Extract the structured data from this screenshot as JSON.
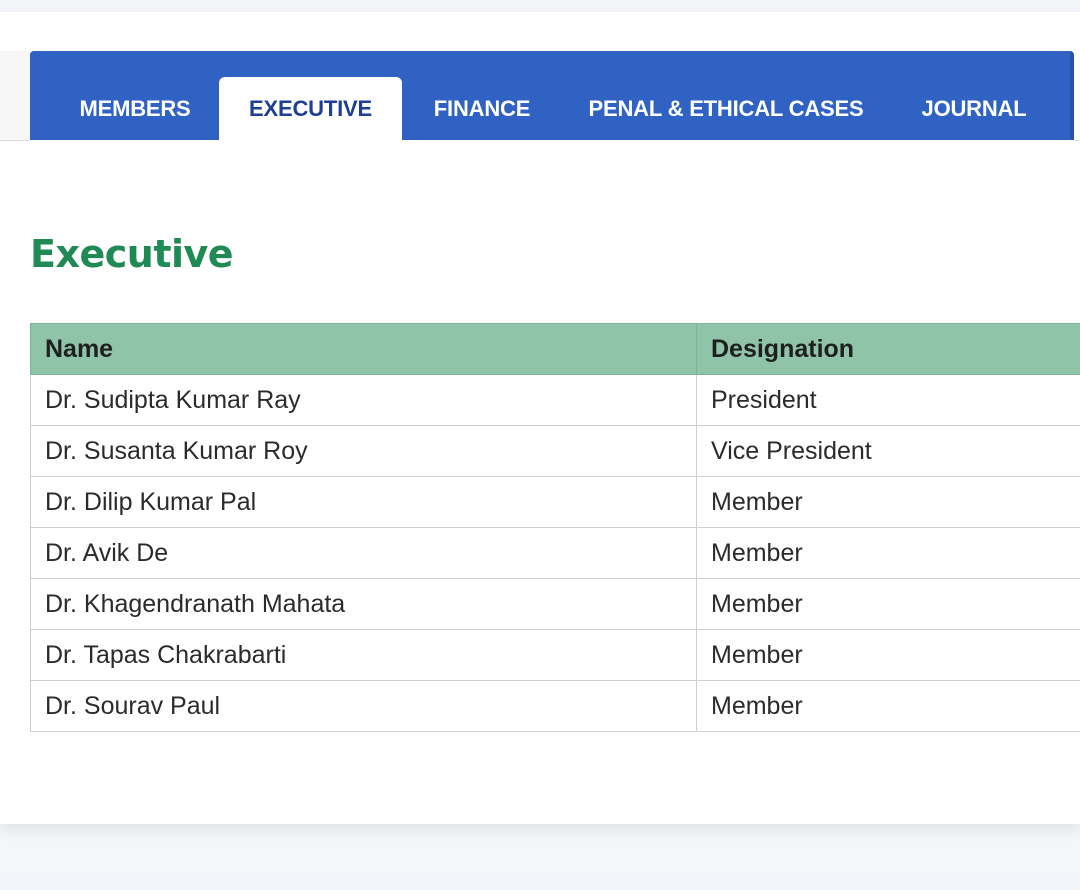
{
  "tabs": [
    {
      "label": "MEMBERS",
      "active": false
    },
    {
      "label": "EXECUTIVE",
      "active": true
    },
    {
      "label": "FINANCE",
      "active": false
    },
    {
      "label": "PENAL & ETHICAL CASES",
      "active": false
    },
    {
      "label": "JOURNAL",
      "active": false
    }
  ],
  "colors": {
    "tab_bar": "#2f62c2",
    "active_tab_text": "#1e3f94",
    "title": "#1f8a54",
    "table_header": "#8fc4a9"
  },
  "page_title": "Executive",
  "table": {
    "headers": [
      "Name",
      "Designation"
    ],
    "rows": [
      [
        "Dr. Sudipta Kumar Ray",
        "President"
      ],
      [
        "Dr. Susanta Kumar Roy",
        "Vice President"
      ],
      [
        "Dr. Dilip Kumar Pal",
        "Member"
      ],
      [
        "Dr. Avik De",
        "Member"
      ],
      [
        "Dr. Khagendranath Mahata",
        "Member"
      ],
      [
        "Dr. Tapas Chakrabarti",
        "Member"
      ],
      [
        "Dr. Sourav Paul",
        "Member"
      ]
    ]
  }
}
